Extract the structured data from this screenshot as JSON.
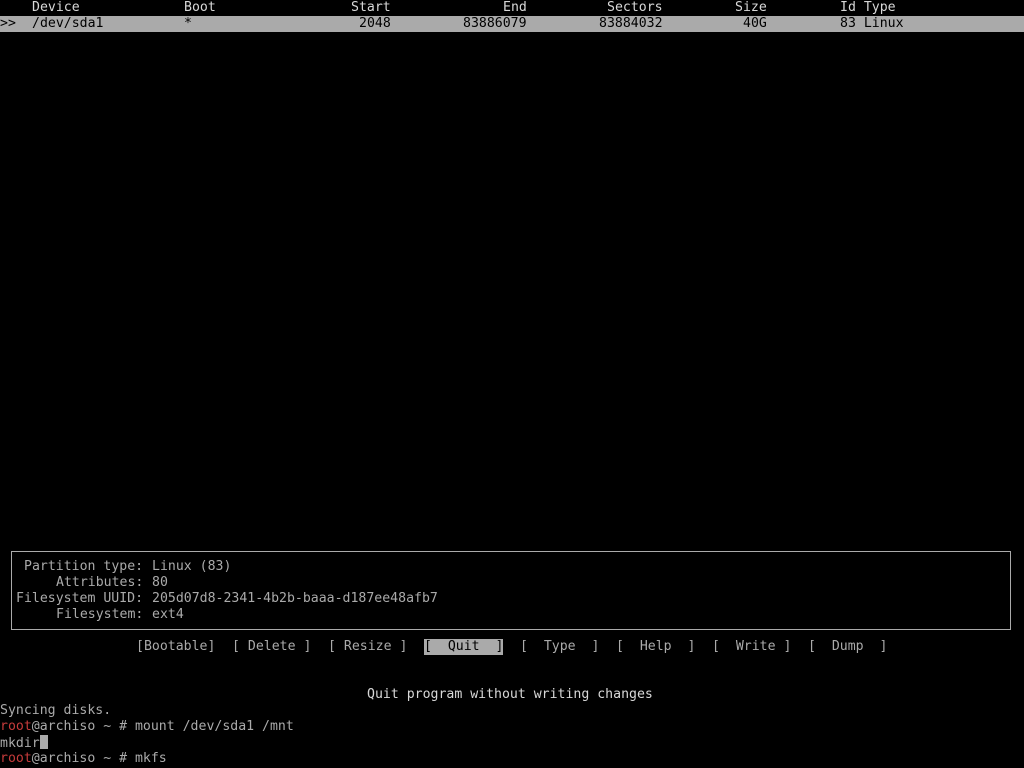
{
  "table": {
    "headers": {
      "device": "Device",
      "boot": "Boot",
      "start": "Start",
      "end": "End",
      "sectors": "Sectors",
      "size": "Size",
      "id_type": "Id Type"
    },
    "rows": [
      {
        "marker": ">>",
        "device": "/dev/sda1",
        "boot": "*",
        "start": "2048",
        "end": "83886079",
        "sectors": "83884032",
        "size": "40G",
        "id_type": "83 Linux"
      }
    ]
  },
  "info": {
    "partition_type_label": "Partition type:",
    "partition_type_value": "Linux (83)",
    "attributes_label": "Attributes:",
    "attributes_value": "80",
    "fs_uuid_label": "Filesystem UUID:",
    "fs_uuid_value": "205d07d8-2341-4b2b-baaa-d187ee48afb7",
    "filesystem_label": "Filesystem:",
    "filesystem_value": "ext4"
  },
  "menu": {
    "bootable": "[Bootable]",
    "delete": "[ Delete ]",
    "resize": "[ Resize ]",
    "quit": "[  Quit  ]",
    "type": "[  Type  ]",
    "help": "[  Help  ]",
    "write": "[  Write ]",
    "dump": "[  Dump  ]",
    "active": "quit"
  },
  "hint": "Quit program without writing changes",
  "terminal": {
    "line1": "Syncing disks.",
    "prompt_user": "root",
    "prompt_host": "@archiso ~ # ",
    "cmd1": "mount /dev/sda1 /mnt",
    "line3": "mkdir",
    "cmd3": "mkfs"
  },
  "colors": {
    "background": "#000000",
    "foreground": "#aaaaaa",
    "highlight": "#aaaaaa",
    "prompt_user": "#c63b3b"
  }
}
